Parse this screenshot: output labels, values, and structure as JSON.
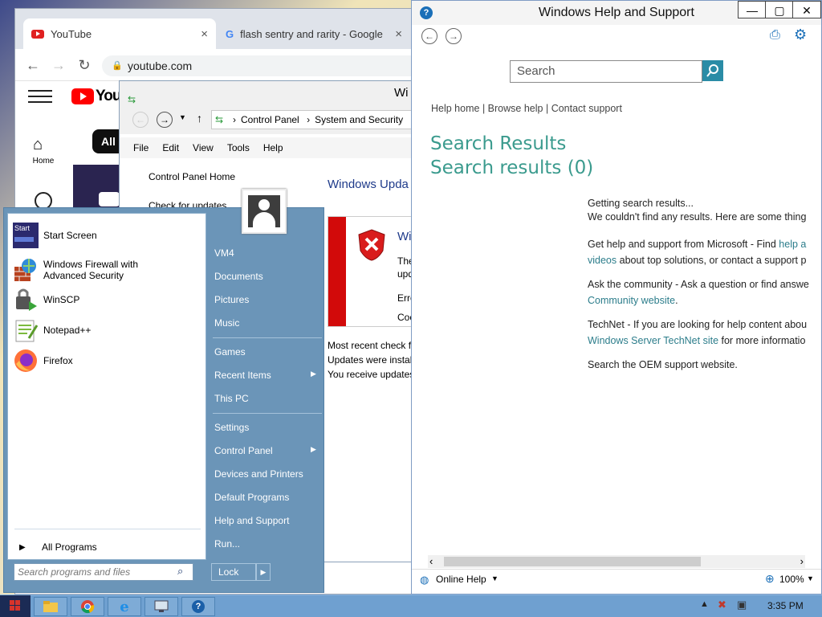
{
  "chrome": {
    "tabs": [
      {
        "label": "YouTube",
        "close": "×"
      },
      {
        "label": "flash sentry and rarity - Google S",
        "close": "×"
      }
    ],
    "url": "youtube.com",
    "yt_home_label": "Home",
    "yt_chip_all": "All",
    "yt_logo_text": "You"
  },
  "cpanel": {
    "title_partial": "Wi",
    "breadcrumb": [
      "Control Panel",
      "System and Security"
    ],
    "menu": [
      "File",
      "Edit",
      "View",
      "Tools",
      "Help"
    ],
    "left_nav": [
      "Control Panel Home",
      "Check for updates"
    ],
    "heading": "Windows Upda",
    "alert_title": "Wi",
    "alert_lines": [
      "The",
      "upd",
      "Erro",
      "Coc"
    ],
    "status_lines": [
      "Most recent check f",
      "Updates were install",
      "You receive updates"
    ]
  },
  "help": {
    "title": "Windows Help and Support",
    "search_placeholder": "Search",
    "links": {
      "home": "Help home",
      "browse": "Browse help",
      "contact": "Contact support",
      "sep": "|"
    },
    "results_title_1": "Search Results",
    "results_title_2": "Search results (0)",
    "getting": "Getting search results...",
    "no_results": "We couldn't find any results. Here are some thing",
    "p1_text": "Get help and support from Microsoft - Find ",
    "p1_link": "help a",
    "p1_link2": "videos",
    "p1_text2": " about top solutions, or contact a support p",
    "p2_text": "Ask the community - Ask a question or find answe",
    "p2_link": "Community website",
    "p2_end": ".",
    "p3_text": "TechNet - If you are looking for help content abou",
    "p3_link": "Windows Server TechNet site",
    "p3_text2": " for more informatio",
    "p4_text": "Search the OEM support website.",
    "online_help": "Online Help",
    "zoom": "100%",
    "win_buttons": [
      "—",
      "▢",
      "✕"
    ]
  },
  "start_menu": {
    "pinned": [
      {
        "label": "Start Screen",
        "icon_text": "Start"
      },
      {
        "label": "Windows Firewall with",
        "label2": "Advanced Security"
      },
      {
        "label": "WinSCP"
      },
      {
        "label": "Notepad++"
      },
      {
        "label": "Firefox"
      }
    ],
    "all_programs": "All Programs",
    "search_placeholder": "Search programs and files",
    "right": [
      "VM4",
      "Documents",
      "Pictures",
      "Music",
      "Games",
      "Recent Items",
      "This PC",
      "Settings",
      "Control Panel",
      "Devices and Printers",
      "Default Programs",
      "Help and Support",
      "Run..."
    ],
    "lock": "Lock"
  },
  "taskbar": {
    "time": "3:35 PM"
  }
}
